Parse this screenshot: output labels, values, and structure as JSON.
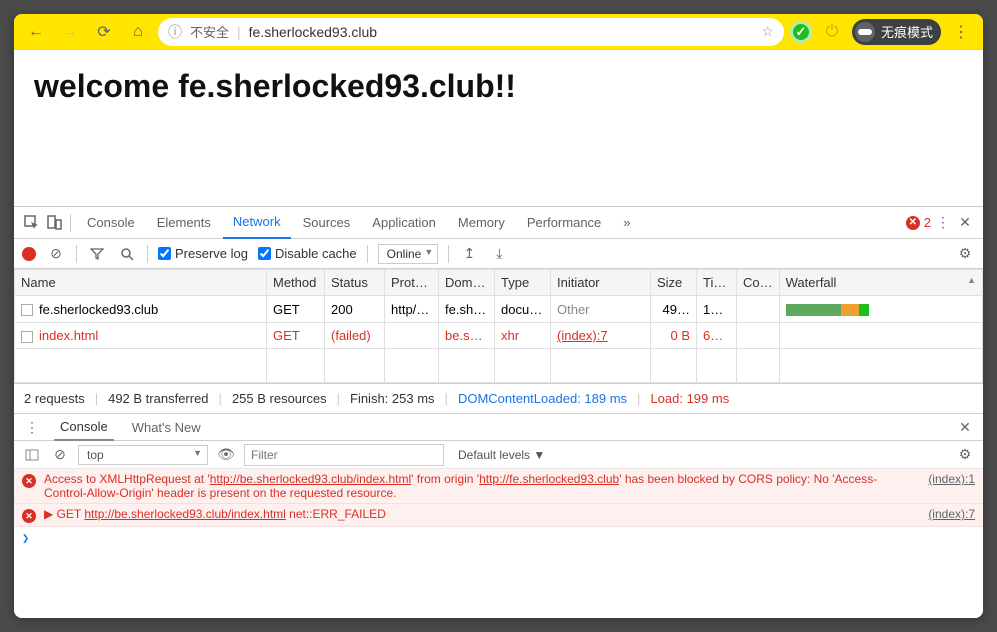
{
  "toolbar": {
    "security_label": "不安全",
    "url": "fe.sherlocked93.club",
    "incognito_label": "无痕模式"
  },
  "page": {
    "heading": "welcome fe.sherlocked93.club!!"
  },
  "devtools": {
    "tabs": [
      "Console",
      "Elements",
      "Network",
      "Sources",
      "Application",
      "Memory",
      "Performance"
    ],
    "active_tab": "Network",
    "error_count": "2"
  },
  "network_toolbar": {
    "preserve_log": "Preserve log",
    "disable_cache": "Disable cache",
    "throttling": "Online"
  },
  "network": {
    "columns": [
      "Name",
      "Method",
      "Status",
      "Prot…",
      "Dom…",
      "Type",
      "Initiator",
      "Size",
      "Ti…",
      "Co…",
      "Waterfall"
    ],
    "rows": [
      {
        "name": "fe.sherlocked93.club",
        "method": "GET",
        "status": "200",
        "protocol": "http/…",
        "domain": "fe.sh…",
        "type": "docu…",
        "initiator": "Other",
        "size": "49…",
        "time": "1…",
        "cookies": "",
        "failed": false,
        "waterfall": {
          "start": 0,
          "segments": [
            {
              "w": 55,
              "c": "#5fa85f"
            },
            {
              "w": 18,
              "c": "#f0a030"
            },
            {
              "w": 10,
              "c": "#1dbf1d"
            }
          ]
        }
      },
      {
        "name": "index.html",
        "method": "GET",
        "status": "(failed)",
        "protocol": "",
        "domain": "be.s…",
        "type": "xhr",
        "initiator": "(index):7",
        "size": "0 B",
        "time": "6…",
        "cookies": "",
        "failed": true,
        "waterfall": null
      }
    ]
  },
  "network_footer": {
    "requests": "2 requests",
    "transferred": "492 B transferred",
    "resources": "255 B resources",
    "finish": "Finish: 253 ms",
    "dcl": "DOMContentLoaded: 189 ms",
    "load": "Load: 199 ms"
  },
  "drawer": {
    "tabs": [
      "Console",
      "What's New"
    ],
    "active": "Console"
  },
  "console_toolbar": {
    "context": "top",
    "filter_placeholder": "Filter",
    "levels": "Default levels ▼"
  },
  "console": {
    "messages": [
      {
        "type": "error",
        "text_parts": [
          {
            "t": "Access to XMLHttpRequest at '"
          },
          {
            "t": "http://be.sherlocked93.club/index.html",
            "u": true
          },
          {
            "t": "' from origin '"
          },
          {
            "t": "http://fe.sherlocked93.club",
            "u": true
          },
          {
            "t": "' has been blocked by CORS policy: No 'Access-Control-Allow-Origin' header is present on the requested resource."
          }
        ],
        "src": "(index):1"
      },
      {
        "type": "error",
        "text_parts": [
          {
            "t": "▶ GET "
          },
          {
            "t": "http://be.sherlocked93.club/index.html",
            "u": true
          },
          {
            "t": " net::ERR_FAILED"
          }
        ],
        "src": "(index):7"
      }
    ]
  }
}
